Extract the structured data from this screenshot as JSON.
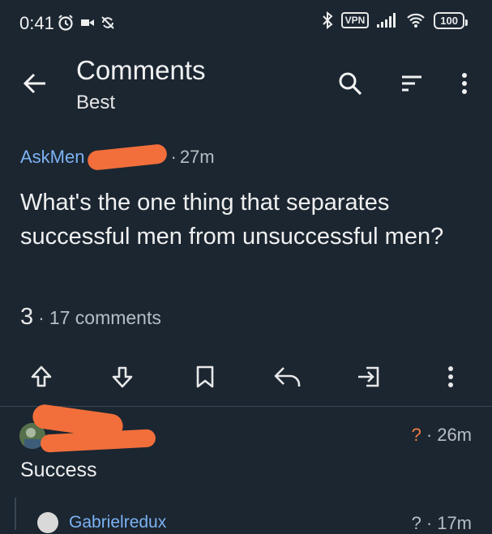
{
  "status_bar": {
    "time": "0:41",
    "vpn": "VPN",
    "battery": "100"
  },
  "header": {
    "title": "Comments",
    "sort": "Best"
  },
  "post": {
    "subreddit": "AskMen",
    "separator": "·",
    "time": "27m",
    "title": "What's the one thing that separates successful men from unsuccessful men?",
    "score": "3",
    "comments": "17 comments"
  },
  "comments": [
    {
      "body": "Success",
      "flag": "?",
      "time": "26m"
    }
  ],
  "reply": {
    "user": "Gabrielredux",
    "flag": "?",
    "time": "17m"
  },
  "colors": {
    "background": "#1b2631",
    "link": "#7db2f2",
    "accent": "#f27b43",
    "redaction": "#f26f3b"
  }
}
